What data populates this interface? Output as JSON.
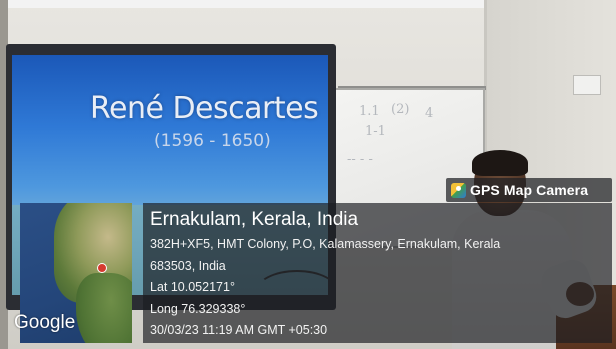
{
  "slide": {
    "title": "René Descartes",
    "years": "(1596 - 1650)"
  },
  "whiteboard": {
    "scribbles": [
      "1.1",
      "(2)",
      "4",
      "1-1",
      "-- - -"
    ]
  },
  "gps_overlay": {
    "app_name": "GPS Map Camera",
    "icon": "gps-map-camera-icon",
    "location_title": "Ernakulam, Kerala, India",
    "address_line_1": "382H+XF5, HMT Colony, P.O, Kalamassery, Ernakulam, Kerala",
    "address_line_2": "683503, India",
    "latitude": "Lat 10.052171°",
    "longitude": "Long 76.329338°",
    "datetime": "30/03/23 11:19 AM GMT +05:30",
    "map_provider": "Google"
  },
  "colors": {
    "overlay_bg": "#1c1e22",
    "slide_blue": "#2f79d6",
    "map_marker": "#d63a2f"
  }
}
